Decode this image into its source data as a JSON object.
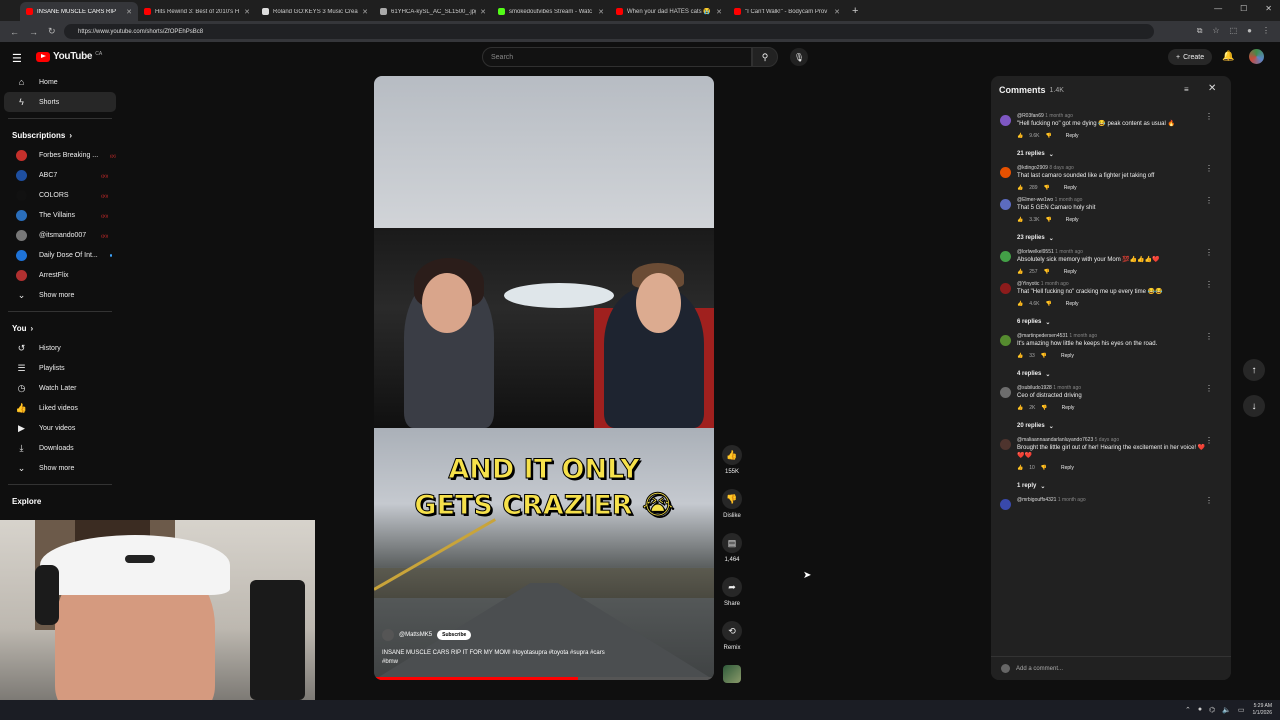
{
  "browser": {
    "tabs": [
      {
        "title": "INSANE MUSCLE CARS RIP",
        "color": "#ff0000",
        "active": true
      },
      {
        "title": "Hits Rewind 3: Best of 2010's H",
        "color": "#ff0000",
        "active": false
      },
      {
        "title": "Roland GO:KEYS 3 Music Creati",
        "color": "#dddddd",
        "active": false
      },
      {
        "title": "61YHCA-kySL_AC_SL1500_.jpg",
        "color": "#aaaaaa",
        "active": false
      },
      {
        "title": "smokedoutvibes Stream - Watc",
        "color": "#53fc18",
        "active": false
      },
      {
        "title": "When your dad HATES cats 😭 (",
        "color": "#ff0000",
        "active": false
      },
      {
        "title": "\"I Can't Walk!\" - Bodycam Prov",
        "color": "#ff0000",
        "active": false
      }
    ],
    "new_tab": "+",
    "url": "https://www.youtube.com/shorts/ZfOPEhPsBc8"
  },
  "header": {
    "logo": "YouTube",
    "logo_region": "CA",
    "search_placeholder": "Search",
    "create_label": "Create"
  },
  "sidebar": {
    "main": [
      {
        "label": "Home",
        "icon": "home-icon",
        "glyph": "⌂",
        "selected": false
      },
      {
        "label": "Shorts",
        "icon": "shorts-icon",
        "glyph": "ϟ",
        "selected": true
      }
    ],
    "subscriptions_title": "Subscriptions",
    "subscriptions": [
      {
        "label": "Forbes Breaking ...",
        "color": "#c4302b",
        "status": "live"
      },
      {
        "label": "ABC7",
        "color": "#1e4fa0",
        "status": "live"
      },
      {
        "label": "COLORS",
        "color": "#111111",
        "status": "live"
      },
      {
        "label": "The Villains",
        "color": "#2a6ebb",
        "status": "live"
      },
      {
        "label": "@itsmando007",
        "color": "#777777",
        "status": "live"
      },
      {
        "label": "Daily Dose Of Int...",
        "color": "#1e73d8",
        "status": "dot"
      },
      {
        "label": "ArrestFlix",
        "color": "#b03030",
        "status": "none"
      }
    ],
    "show_more": "Show more",
    "you_title": "You",
    "you": [
      {
        "label": "History",
        "icon": "history-icon",
        "glyph": "↺"
      },
      {
        "label": "Playlists",
        "icon": "playlists-icon",
        "glyph": "☰"
      },
      {
        "label": "Watch Later",
        "icon": "watch-later-icon",
        "glyph": "◷"
      },
      {
        "label": "Liked videos",
        "icon": "liked-icon",
        "glyph": "👍"
      },
      {
        "label": "Your videos",
        "icon": "your-videos-icon",
        "glyph": "▶"
      },
      {
        "label": "Downloads",
        "icon": "downloads-icon",
        "glyph": "⤓"
      }
    ],
    "show_more_2": "Show more",
    "explore_title": "Explore"
  },
  "short": {
    "caption_line1": "AND IT ONLY",
    "caption_line2": "GETS CRAZIER 😭",
    "channel": "@MattsMK5",
    "subscribe": "Subscribe",
    "title": "INSANE MUSCLE CARS RIP IT FOR MY MOM! #toyotasupra #toyota #supra #cars #bmw",
    "progress": 0.6
  },
  "actions": {
    "likes": "155K",
    "dislike": "Dislike",
    "comments": "1,464",
    "share": "Share",
    "remix": "Remix"
  },
  "comments": {
    "title": "Comments",
    "count": "1.4K",
    "add_placeholder": "Add a comment...",
    "items": [
      {
        "user": "@R03fan69",
        "age": "1 month ago",
        "text": "\"Hell fucking no\" got me dying 😂 peak content as usual 🔥",
        "likes": "9.6K",
        "reply": "Reply",
        "color": "#7e57c2",
        "replies": "21 replies"
      },
      {
        "user": "@kdingo2909",
        "age": "8 days ago",
        "text": "That last camaro sounded like a fighter jet taking off",
        "likes": "289",
        "reply": "Reply",
        "color": "#e65100",
        "replies": ""
      },
      {
        "user": "@Elmer-ww1wo",
        "age": "1 month ago",
        "text": "That 5 GEN Camaro holy shit",
        "likes": "3.3K",
        "reply": "Reply",
        "color": "#5c6bc0",
        "replies": "23 replies"
      },
      {
        "user": "@lorlwelkel9551",
        "age": "1 month ago",
        "text": "Absolutely sick memory with your Mom 💯👍👍👍❤️",
        "likes": "257",
        "reply": "Reply",
        "color": "#43a047",
        "replies": ""
      },
      {
        "user": "@Yinyotic",
        "age": "1 month ago",
        "text": "That \"Hell fucking no\" cracking me up every time 😂😂",
        "likes": "4.6K",
        "reply": "Reply",
        "color": "#8d1c1c",
        "replies": "6 replies"
      },
      {
        "user": "@martinpedersen4531",
        "age": "1 month ago",
        "text": "It's amazing how little he keeps his eyes on the road.",
        "likes": "33",
        "reply": "Reply",
        "color": "#558b2f",
        "replies": "4 replies"
      },
      {
        "user": "@subiludo1928",
        "age": "1 month ago",
        "text": "Ceo of distracted driving",
        "likes": "2K",
        "reply": "Reply",
        "color": "#6d6d6d",
        "replies": "20 replies"
      },
      {
        "user": "@maliaannaandarlanluyando7623",
        "age": "5 days ago",
        "text": "Brought the little girl out of her! Hearing the excitement in her voice! ❤️❤️❤️",
        "likes": "10",
        "reply": "Reply",
        "color": "#4e342e",
        "replies": "1 reply"
      },
      {
        "user": "@mrbigouffs4321",
        "age": "1 month ago",
        "text": "",
        "likes": "",
        "reply": "",
        "color": "#3949ab",
        "replies": ""
      }
    ]
  },
  "taskbar": {
    "time": "5:29 AM",
    "date": "1/1/2026"
  }
}
